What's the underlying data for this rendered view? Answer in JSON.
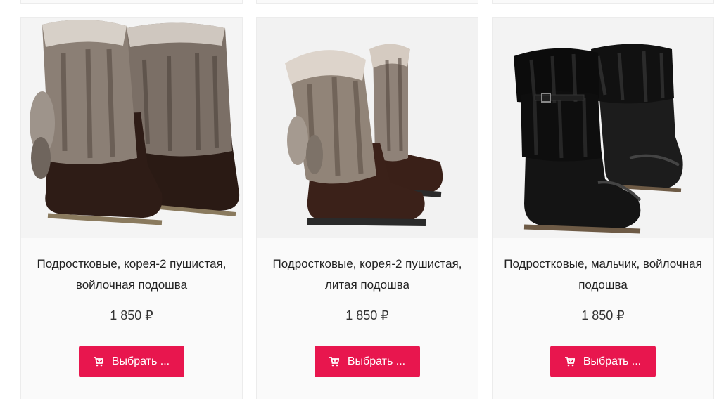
{
  "products": [
    {
      "title": "Подростковые, корея-2 пушистая, войлочная подошва",
      "price": "1 850 ₽",
      "button_label": "Выбрать ...",
      "image_alt": "gray fur boots with brown suede",
      "variant": "suede-fur"
    },
    {
      "title": "Подростковые, корея-2 пушистая, литая подошва",
      "price": "1 850 ₽",
      "button_label": "Выбрать ...",
      "image_alt": "fluffy fur boots with cast sole",
      "variant": "suede-fur-cast"
    },
    {
      "title": "Подростковые, мальчик, войлочная подошва",
      "price": "1 850 ₽",
      "button_label": "Выбрать ...",
      "image_alt": "black leather boots with sheepskin cuff",
      "variant": "leather-black"
    }
  ],
  "colors": {
    "accent": "#e8164e",
    "card_bg": "#fafafa",
    "border": "#ececec"
  },
  "icons": {
    "button_icon": "cart-icon"
  }
}
